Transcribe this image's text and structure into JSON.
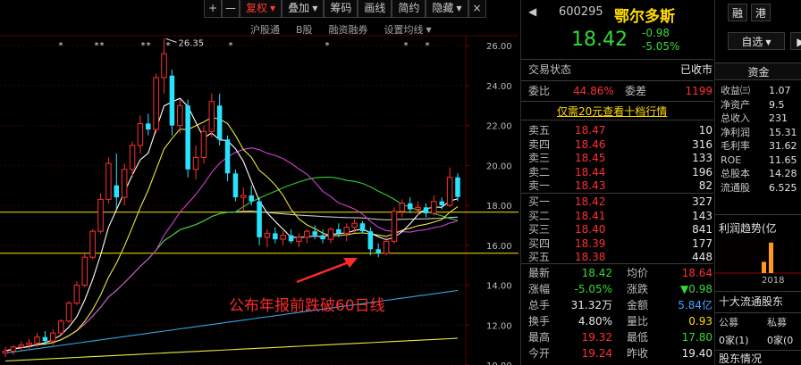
{
  "toolbar": {
    "zoom_in": "+",
    "zoom_out": "—",
    "items": [
      {
        "label": "复权",
        "active": true,
        "dropdown": true
      },
      {
        "label": "叠加",
        "active": false,
        "dropdown": true
      },
      {
        "label": "筹码",
        "active": false,
        "dropdown": false
      },
      {
        "label": "画线",
        "active": false,
        "dropdown": false
      },
      {
        "label": "简约",
        "active": false,
        "dropdown": false
      },
      {
        "label": "隐藏",
        "active": false,
        "dropdown": true
      }
    ],
    "close": "×"
  },
  "subtoolbar": {
    "items": [
      "沪股通",
      "B股",
      "融资融券",
      "设置均线"
    ]
  },
  "chart_data": {
    "type": "candlestick",
    "y_ticks": [
      "26.00",
      "24.00",
      "22.00",
      "20.00",
      "18.00",
      "16.00",
      "14.00",
      "12.00",
      "10.00"
    ],
    "ylim": [
      10,
      26.5
    ],
    "peak_label": "26.35",
    "peak_value": 26.35,
    "annotation": "公布年报前跌破60日线",
    "yellow_lines": [
      17.66,
      15.6
    ],
    "candles": [
      {
        "o": 10.6,
        "h": 10.9,
        "l": 10.4,
        "c": 10.7
      },
      {
        "o": 10.7,
        "h": 11.0,
        "l": 10.5,
        "c": 10.9
      },
      {
        "o": 10.9,
        "h": 11.2,
        "l": 10.7,
        "c": 11.0
      },
      {
        "o": 11.0,
        "h": 11.3,
        "l": 10.8,
        "c": 11.1
      },
      {
        "o": 11.1,
        "h": 11.6,
        "l": 10.9,
        "c": 11.4
      },
      {
        "o": 11.4,
        "h": 11.7,
        "l": 11.0,
        "c": 11.2
      },
      {
        "o": 11.2,
        "h": 11.8,
        "l": 11.0,
        "c": 11.6
      },
      {
        "o": 11.6,
        "h": 12.3,
        "l": 11.5,
        "c": 12.2
      },
      {
        "o": 12.2,
        "h": 13.2,
        "l": 12.1,
        "c": 13.1
      },
      {
        "o": 13.1,
        "h": 14.2,
        "l": 13.0,
        "c": 14.0
      },
      {
        "o": 14.0,
        "h": 15.6,
        "l": 13.9,
        "c": 15.4
      },
      {
        "o": 15.4,
        "h": 16.8,
        "l": 15.3,
        "c": 16.7
      },
      {
        "o": 16.7,
        "h": 18.6,
        "l": 16.6,
        "c": 18.3
      },
      {
        "o": 18.3,
        "h": 20.4,
        "l": 18.1,
        "c": 20.1
      },
      {
        "o": 19.0,
        "h": 20.6,
        "l": 17.8,
        "c": 18.4
      },
      {
        "o": 18.4,
        "h": 20.1,
        "l": 18.0,
        "c": 19.8
      },
      {
        "o": 19.8,
        "h": 21.2,
        "l": 19.4,
        "c": 21.0
      },
      {
        "o": 21.0,
        "h": 22.5,
        "l": 20.6,
        "c": 22.1
      },
      {
        "o": 22.1,
        "h": 22.6,
        "l": 21.5,
        "c": 21.8
      },
      {
        "o": 21.8,
        "h": 24.6,
        "l": 21.6,
        "c": 24.4
      },
      {
        "o": 24.4,
        "h": 26.35,
        "l": 23.6,
        "c": 25.6
      },
      {
        "o": 24.5,
        "h": 24.8,
        "l": 21.5,
        "c": 22.0
      },
      {
        "o": 22.0,
        "h": 23.3,
        "l": 21.6,
        "c": 23.0
      },
      {
        "o": 23.0,
        "h": 23.3,
        "l": 19.4,
        "c": 19.8
      },
      {
        "o": 19.8,
        "h": 21.0,
        "l": 19.3,
        "c": 20.4
      },
      {
        "o": 20.4,
        "h": 22.0,
        "l": 20.1,
        "c": 21.7
      },
      {
        "o": 21.7,
        "h": 23.6,
        "l": 21.4,
        "c": 23.2
      },
      {
        "o": 23.0,
        "h": 23.6,
        "l": 21.0,
        "c": 21.3
      },
      {
        "o": 21.3,
        "h": 21.5,
        "l": 19.2,
        "c": 19.6
      },
      {
        "o": 19.6,
        "h": 19.8,
        "l": 18.2,
        "c": 18.4
      },
      {
        "o": 18.4,
        "h": 18.9,
        "l": 17.7,
        "c": 18.5
      },
      {
        "o": 18.5,
        "h": 19.0,
        "l": 18.0,
        "c": 18.2
      },
      {
        "o": 18.2,
        "h": 18.4,
        "l": 16.0,
        "c": 16.4
      },
      {
        "o": 16.4,
        "h": 16.8,
        "l": 15.9,
        "c": 16.6
      },
      {
        "o": 16.6,
        "h": 16.9,
        "l": 16.1,
        "c": 16.3
      },
      {
        "o": 16.3,
        "h": 16.7,
        "l": 16.0,
        "c": 16.5
      },
      {
        "o": 16.5,
        "h": 16.8,
        "l": 16.1,
        "c": 16.2
      },
      {
        "o": 16.2,
        "h": 16.6,
        "l": 15.9,
        "c": 16.4
      },
      {
        "o": 16.4,
        "h": 16.8,
        "l": 16.1,
        "c": 16.7
      },
      {
        "o": 16.7,
        "h": 17.0,
        "l": 16.3,
        "c": 16.5
      },
      {
        "o": 16.5,
        "h": 16.8,
        "l": 16.1,
        "c": 16.3
      },
      {
        "o": 16.3,
        "h": 16.9,
        "l": 16.1,
        "c": 16.8
      },
      {
        "o": 16.8,
        "h": 17.1,
        "l": 16.4,
        "c": 16.6
      },
      {
        "o": 16.6,
        "h": 17.1,
        "l": 16.2,
        "c": 16.9
      },
      {
        "o": 16.9,
        "h": 17.3,
        "l": 16.6,
        "c": 17.1
      },
      {
        "o": 17.1,
        "h": 17.2,
        "l": 16.6,
        "c": 16.7
      },
      {
        "o": 16.7,
        "h": 16.9,
        "l": 15.5,
        "c": 15.8
      },
      {
        "o": 15.8,
        "h": 16.1,
        "l": 15.4,
        "c": 15.6
      },
      {
        "o": 15.6,
        "h": 16.4,
        "l": 15.5,
        "c": 16.2
      },
      {
        "o": 16.2,
        "h": 17.9,
        "l": 16.1,
        "c": 17.7
      },
      {
        "o": 17.7,
        "h": 18.3,
        "l": 17.4,
        "c": 18.1
      },
      {
        "o": 18.1,
        "h": 18.4,
        "l": 17.6,
        "c": 17.8
      },
      {
        "o": 17.8,
        "h": 18.2,
        "l": 17.5,
        "c": 17.9
      },
      {
        "o": 17.9,
        "h": 18.1,
        "l": 17.4,
        "c": 17.6
      },
      {
        "o": 17.6,
        "h": 18.5,
        "l": 17.5,
        "c": 18.2
      },
      {
        "o": 18.2,
        "h": 18.4,
        "l": 17.8,
        "c": 18.0
      },
      {
        "o": 18.0,
        "h": 19.9,
        "l": 17.9,
        "c": 19.4
      },
      {
        "o": 19.4,
        "h": 19.6,
        "l": 18.2,
        "c": 18.42
      }
    ]
  },
  "stock": {
    "code": "600295",
    "name": "鄂尔多斯",
    "price": "18.42",
    "change": "-0.98",
    "change_pct": "-5.05%",
    "tag_rong": "融",
    "tag_gang": "港",
    "watch_btn": "自选",
    "nav_prev": "◀",
    "nav_next": "▶"
  },
  "trade_status": {
    "label": "交易状态",
    "value": "已收市"
  },
  "ratio": {
    "wb_label": "委比",
    "wb_value": "44.86%",
    "wc_label": "委差",
    "wc_value": "1199"
  },
  "promo_link": "仅需20元查看十档行情",
  "asks": [
    {
      "label": "卖五",
      "price": "18.47",
      "vol": "10"
    },
    {
      "label": "卖四",
      "price": "18.46",
      "vol": "316"
    },
    {
      "label": "卖三",
      "price": "18.45",
      "vol": "133"
    },
    {
      "label": "卖二",
      "price": "18.44",
      "vol": "196"
    },
    {
      "label": "卖一",
      "price": "18.43",
      "vol": "82"
    }
  ],
  "bids": [
    {
      "label": "买一",
      "price": "18.42",
      "vol": "327"
    },
    {
      "label": "买二",
      "price": "18.41",
      "vol": "143"
    },
    {
      "label": "买三",
      "price": "18.40",
      "vol": "841"
    },
    {
      "label": "买四",
      "price": "18.39",
      "vol": "177"
    },
    {
      "label": "买五",
      "price": "18.38",
      "vol": "448"
    }
  ],
  "stats": [
    {
      "l1": "最新",
      "v1": "18.42",
      "c1": "green",
      "l2": "均价",
      "v2": "18.64",
      "c2": "red"
    },
    {
      "l1": "涨幅",
      "v1": "-5.05%",
      "c1": "green",
      "l2": "涨跌",
      "v2": "▼0.98",
      "c2": "green"
    },
    {
      "l1": "总手",
      "v1": "31.32万",
      "c1": "white",
      "l2": "金额",
      "v2": "5.84亿",
      "c2": "blue"
    },
    {
      "l1": "换手",
      "v1": "4.80%",
      "c1": "white",
      "l2": "量比",
      "v2": "0.93",
      "c2": "yellow"
    },
    {
      "l1": "最高",
      "v1": "19.32",
      "c1": "red",
      "l2": "最低",
      "v2": "17.80",
      "c2": "green"
    },
    {
      "l1": "今开",
      "v1": "19.24",
      "c1": "red",
      "l2": "昨收",
      "v2": "19.40",
      "c2": "white"
    }
  ],
  "side": {
    "capital_tab": "资金",
    "fundamentals": [
      {
        "label": "收益㈢",
        "value": "1.07"
      },
      {
        "label": "净资产",
        "value": "9.5"
      },
      {
        "label": "总收入",
        "value": "231"
      },
      {
        "label": "净利润",
        "value": "15.31"
      },
      {
        "label": "毛利率",
        "value": "31.62"
      },
      {
        "label": "ROE",
        "value": "11.65"
      },
      {
        "label": "总股本",
        "value": "14.28"
      },
      {
        "label": "流通股",
        "value": "6.525"
      }
    ],
    "profit_trend_title": "利润趋势(亿",
    "profit_bars": [
      0.35,
      0.95
    ],
    "profit_year": "2018",
    "holders_title": "十大流通股东",
    "holders_cols": [
      "公募",
      "私募"
    ],
    "holders_vals": [
      "0家(1)",
      "0家(0"
    ],
    "holders_footer": "股东情况"
  }
}
